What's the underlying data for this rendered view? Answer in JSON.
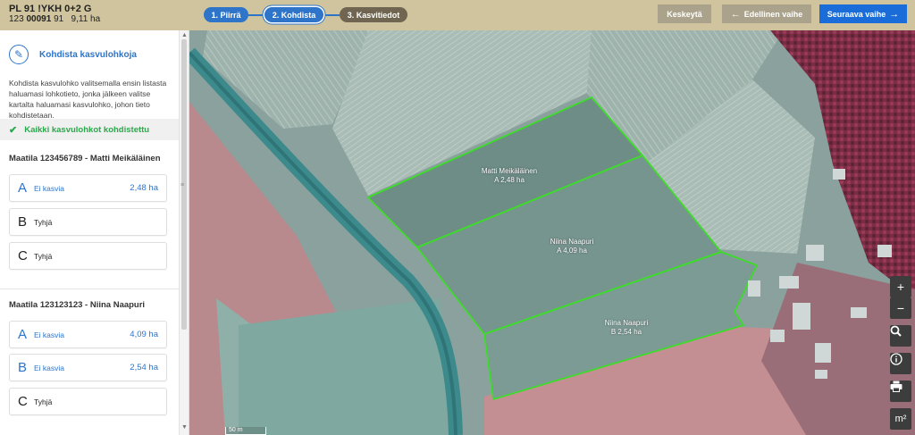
{
  "header": {
    "plot_title": "PL 91 !YKH 0+2 G",
    "plot_code_prefix": "123",
    "plot_code_bold": "00091",
    "plot_code_suffix": "91",
    "plot_area": "9,11 ha"
  },
  "steps": [
    {
      "label": "1. Piirrä"
    },
    {
      "label": "2. Kohdista"
    },
    {
      "label": "3. Kasvitiedot"
    }
  ],
  "buttons": {
    "pause": "Keskeytä",
    "prev": "Edellinen vaihe",
    "next": "Seuraava vaihe"
  },
  "sidebar": {
    "title": "Kohdista kasvulohkoja",
    "description": "Kohdista kasvulohko valitsemalla ensin listasta haluamasi lohkotieto, jonka jälkeen valitse kartalta haluamasi kasvulohko, johon tieto kohdistetaan.",
    "status": "Kaikki kasvulohkot kohdistettu",
    "farms": [
      {
        "title": "Maatila 123456789 - Matti Meikäläinen",
        "plots": [
          {
            "letter": "A",
            "text": "Ei kasvia",
            "area": "2,48 ha"
          },
          {
            "letter": "B",
            "text": "Tyhjä",
            "area": ""
          },
          {
            "letter": "C",
            "text": "Tyhjä",
            "area": ""
          }
        ]
      },
      {
        "title": "Maatila 123123123 - Niina Naapuri",
        "plots": [
          {
            "letter": "A",
            "text": "Ei kasvia",
            "area": "4,09 ha"
          },
          {
            "letter": "B",
            "text": "Ei kasvia",
            "area": "2,54 ha"
          },
          {
            "letter": "C",
            "text": "Tyhjä",
            "area": ""
          }
        ]
      }
    ]
  },
  "map": {
    "fields": [
      {
        "name": "Matti Meikäläinen",
        "area": "A 2,48 ha"
      },
      {
        "name": "Niina Naapuri",
        "area": "A 4,09 ha"
      },
      {
        "name": "Niina Naapuri",
        "area": "B 2,54 ha"
      }
    ],
    "scale_label": "50 m",
    "controls": {
      "zoom_in": "+",
      "zoom_out": "−",
      "area_unit": "m²"
    },
    "field_outline_color": "#3ddc2a"
  },
  "icons": {
    "pen": "pen-icon",
    "check": "check-icon",
    "arrow_left": "arrow-left-icon",
    "arrow_right": "arrow-right-icon",
    "search": "search-icon",
    "info": "info-icon",
    "print": "print-icon"
  }
}
